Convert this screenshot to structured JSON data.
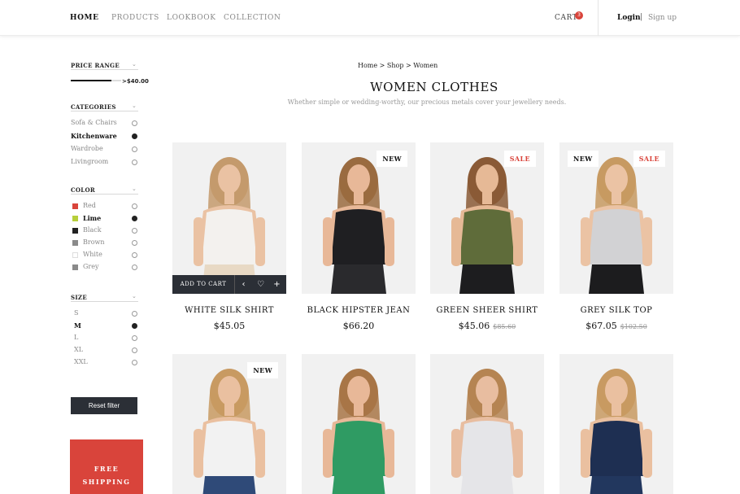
{
  "header": {
    "nav": [
      "HOME",
      "PRODUCTS",
      "LOOKBOOK",
      "COLLECTION"
    ],
    "cart_label": "CART",
    "cart_count": "3",
    "login": "Login",
    "separator": "|",
    "signup": "Sign up"
  },
  "sidebar": {
    "price_title": "PRICE RANGE",
    "price_value": ">$40.00",
    "price_fill_fraction": 0.77,
    "categories_title": "CATEGORIES",
    "categories": [
      {
        "label": "Sofa & Chairs",
        "selected": false
      },
      {
        "label": "Kitchenware",
        "selected": true
      },
      {
        "label": "Wardrobe",
        "selected": false
      },
      {
        "label": "Livingroom",
        "selected": false
      }
    ],
    "color_title": "COLOR",
    "colors": [
      {
        "label": "Red",
        "swatch": "#d9443b",
        "selected": false
      },
      {
        "label": "Lime",
        "swatch": "#b7cf3a",
        "selected": true
      },
      {
        "label": "Black",
        "swatch": "#222222",
        "selected": false
      },
      {
        "label": "Brown",
        "swatch": "#8a8a8a",
        "selected": false
      },
      {
        "label": "White",
        "swatch": "#ffffff",
        "selected": false
      },
      {
        "label": "Grey",
        "swatch": "#8a8a8a",
        "selected": false
      }
    ],
    "size_title": "SIZE",
    "sizes": [
      {
        "label": "S",
        "selected": false
      },
      {
        "label": "M",
        "selected": true
      },
      {
        "label": "L",
        "selected": false
      },
      {
        "label": "XL",
        "selected": false
      },
      {
        "label": "XXL",
        "selected": false
      }
    ],
    "reset_label": "Reset filter",
    "promo_line1": "FREE",
    "promo_line2": "SHIPPING"
  },
  "main": {
    "breadcrumb": "Home > Shop > Women",
    "title": "WOMEN CLOTHES",
    "subtitle": "Whether simple or wedding-worthy, our precious metals cover your jewellery needs.",
    "add_to_cart": "ADD TO CART",
    "products": [
      {
        "name": "WHITE SILK SHIRT",
        "price": "$45.05",
        "old_price": "",
        "badge_left": "",
        "badge_right": "",
        "top": "#f3f1ee",
        "bottom": "#e8d9c4",
        "hair": "#c49a6c",
        "skin": "#eac2a3"
      },
      {
        "name": "BLACK HIPSTER JEAN",
        "price": "$66.20",
        "old_price": "",
        "badge_left": "",
        "badge_right": "NEW",
        "top": "#1f1f22",
        "bottom": "#2a2a2d",
        "hair": "#9a6b40",
        "skin": "#e8b898"
      },
      {
        "name": "GREEN SHEER SHIRT",
        "price": "$45.06",
        "old_price": "$85.60",
        "badge_left": "",
        "badge_right": "SALE",
        "top": "#5f6c3a",
        "bottom": "#1d1d1f",
        "hair": "#8a5a36",
        "skin": "#e6b996"
      },
      {
        "name": "GREY SILK TOP",
        "price": "$67.05",
        "old_price": "$102.50",
        "badge_left": "NEW",
        "badge_right": "SALE",
        "top": "#d2d2d4",
        "bottom": "#1c1c1e",
        "hair": "#c79a62",
        "skin": "#ebc3a4"
      },
      {
        "name": "",
        "price": "",
        "old_price": "",
        "badge_left": "",
        "badge_right": "NEW",
        "top": "#f2f2f2",
        "bottom": "#2f4a78",
        "hair": "#c89a62",
        "skin": "#eac0a0"
      },
      {
        "name": "",
        "price": "",
        "old_price": "",
        "badge_left": "",
        "badge_right": "",
        "top": "#2f9b63",
        "bottom": "#2f9b63",
        "hair": "#a87546",
        "skin": "#e8b898"
      },
      {
        "name": "",
        "price": "",
        "old_price": "",
        "badge_left": "",
        "badge_right": "",
        "top": "#e5e5e8",
        "bottom": "#e5e5e8",
        "hair": "#b58452",
        "skin": "#e8bda0"
      },
      {
        "name": "",
        "price": "",
        "old_price": "",
        "badge_left": "",
        "badge_right": "",
        "top": "#1e2f52",
        "bottom": "#22375e",
        "hair": "#c89a62",
        "skin": "#eac0a0"
      }
    ]
  }
}
